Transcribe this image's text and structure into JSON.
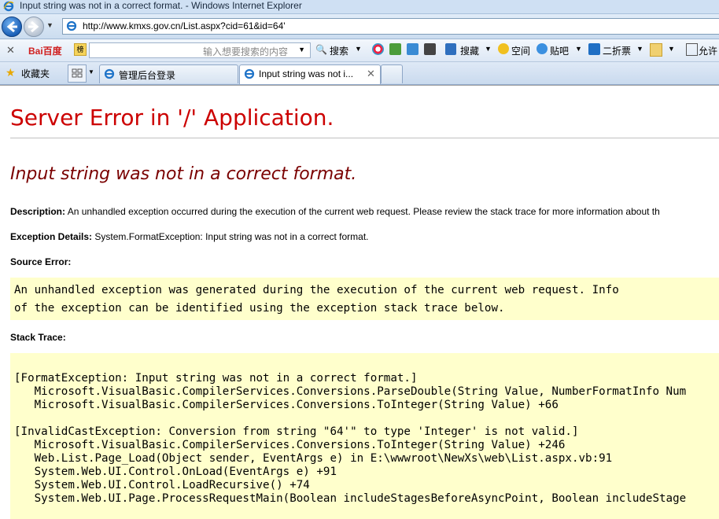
{
  "window": {
    "title": "Input string was not in a correct format. - Windows Internet Explorer"
  },
  "address": {
    "url": "http://www.kmxs.gov.cn/List.aspx?cid=61&id=64'"
  },
  "toolbar": {
    "baidu_logo": "Bai百度",
    "search_placeholder": "输入想要搜索的内容",
    "search_label": "搜索",
    "favorites_btn": "搜藏",
    "space_label": "空间",
    "tieba_label": "贴吧",
    "discount_label": "二折票",
    "allow_label": "允许"
  },
  "tabs": {
    "favorites_label": "收藏夹",
    "items": [
      {
        "label": "管理后台登录"
      },
      {
        "label": "Input string was not i..."
      }
    ]
  },
  "page": {
    "heading": "Server Error in '/' Application.",
    "message": "Input string was not in a correct format.",
    "description_label": "Description:",
    "description_text": "An unhandled exception occurred during the execution of the current web request. Please review the stack trace for more information about th",
    "exception_label": "Exception Details:",
    "exception_text": "System.FormatException: Input string was not in a correct format.",
    "source_label": "Source Error:",
    "source_lines": [
      "An unhandled exception was generated during the execution of the current web request. Info",
      "of the exception can be identified using the exception stack trace below."
    ],
    "stack_label": "Stack Trace:",
    "stack_lines": [
      "[FormatException: Input string was not in a correct format.]",
      "   Microsoft.VisualBasic.CompilerServices.Conversions.ParseDouble(String Value, NumberFormatInfo Num",
      "   Microsoft.VisualBasic.CompilerServices.Conversions.ToInteger(String Value) +66",
      "",
      "[InvalidCastException: Conversion from string \"64'\" to type 'Integer' is not valid.]",
      "   Microsoft.VisualBasic.CompilerServices.Conversions.ToInteger(String Value) +246",
      "   Web.List.Page_Load(Object sender, EventArgs e) in E:\\wwwroot\\NewXs\\web\\List.aspx.vb:91",
      "   System.Web.UI.Control.OnLoad(EventArgs e) +91",
      "   System.Web.UI.Control.LoadRecursive() +74",
      "   System.Web.UI.Page.ProcessRequestMain(Boolean includeStagesBeforeAsyncPoint, Boolean includeStage"
    ]
  }
}
